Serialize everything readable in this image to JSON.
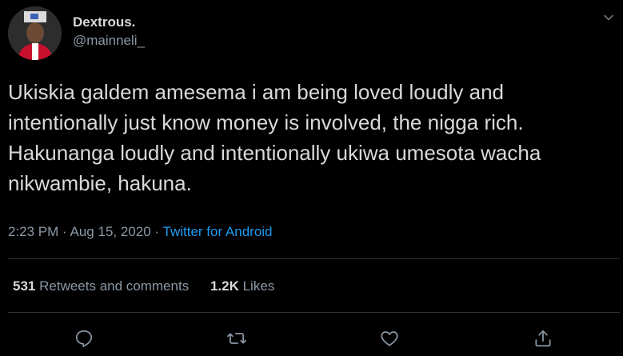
{
  "user": {
    "display_name": "Dextrous.",
    "handle": "@mainneli_"
  },
  "tweet": {
    "text": "Ukiskia galdem amesema i am being loved loudly and intentionally just know money is involved, the nigga rich. Hakunanga loudly and intentionally ukiwa umesota wacha nikwambie, hakuna.",
    "time": "2:23 PM",
    "separator": "·",
    "date": "Aug 15, 2020",
    "source": "Twitter for Android"
  },
  "stats": {
    "retweets_count": "531",
    "retweets_label": "Retweets and comments",
    "likes_count": "1.2K",
    "likes_label": "Likes"
  },
  "icons": {
    "menu": "chevron-down-icon",
    "reply": "reply-icon",
    "retweet": "retweet-icon",
    "like": "heart-icon",
    "share": "share-icon"
  },
  "colors": {
    "background": "#000000",
    "text": "#d9d9d9",
    "secondary": "#8b98a5",
    "link": "#1d9bf0",
    "divider": "#2f3336"
  }
}
